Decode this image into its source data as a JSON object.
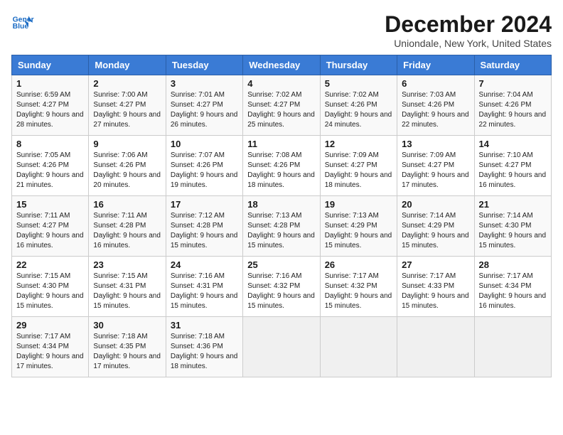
{
  "logo": {
    "line1": "General",
    "line2": "Blue"
  },
  "title": "December 2024",
  "subtitle": "Uniondale, New York, United States",
  "days_of_week": [
    "Sunday",
    "Monday",
    "Tuesday",
    "Wednesday",
    "Thursday",
    "Friday",
    "Saturday"
  ],
  "weeks": [
    [
      {
        "day": "1",
        "sunrise": "6:59 AM",
        "sunset": "4:27 PM",
        "daylight": "9 hours and 28 minutes."
      },
      {
        "day": "2",
        "sunrise": "7:00 AM",
        "sunset": "4:27 PM",
        "daylight": "9 hours and 27 minutes."
      },
      {
        "day": "3",
        "sunrise": "7:01 AM",
        "sunset": "4:27 PM",
        "daylight": "9 hours and 26 minutes."
      },
      {
        "day": "4",
        "sunrise": "7:02 AM",
        "sunset": "4:27 PM",
        "daylight": "9 hours and 25 minutes."
      },
      {
        "day": "5",
        "sunrise": "7:02 AM",
        "sunset": "4:26 PM",
        "daylight": "9 hours and 24 minutes."
      },
      {
        "day": "6",
        "sunrise": "7:03 AM",
        "sunset": "4:26 PM",
        "daylight": "9 hours and 22 minutes."
      },
      {
        "day": "7",
        "sunrise": "7:04 AM",
        "sunset": "4:26 PM",
        "daylight": "9 hours and 22 minutes."
      }
    ],
    [
      {
        "day": "8",
        "sunrise": "7:05 AM",
        "sunset": "4:26 PM",
        "daylight": "9 hours and 21 minutes."
      },
      {
        "day": "9",
        "sunrise": "7:06 AM",
        "sunset": "4:26 PM",
        "daylight": "9 hours and 20 minutes."
      },
      {
        "day": "10",
        "sunrise": "7:07 AM",
        "sunset": "4:26 PM",
        "daylight": "9 hours and 19 minutes."
      },
      {
        "day": "11",
        "sunrise": "7:08 AM",
        "sunset": "4:26 PM",
        "daylight": "9 hours and 18 minutes."
      },
      {
        "day": "12",
        "sunrise": "7:09 AM",
        "sunset": "4:27 PM",
        "daylight": "9 hours and 18 minutes."
      },
      {
        "day": "13",
        "sunrise": "7:09 AM",
        "sunset": "4:27 PM",
        "daylight": "9 hours and 17 minutes."
      },
      {
        "day": "14",
        "sunrise": "7:10 AM",
        "sunset": "4:27 PM",
        "daylight": "9 hours and 16 minutes."
      }
    ],
    [
      {
        "day": "15",
        "sunrise": "7:11 AM",
        "sunset": "4:27 PM",
        "daylight": "9 hours and 16 minutes."
      },
      {
        "day": "16",
        "sunrise": "7:11 AM",
        "sunset": "4:28 PM",
        "daylight": "9 hours and 16 minutes."
      },
      {
        "day": "17",
        "sunrise": "7:12 AM",
        "sunset": "4:28 PM",
        "daylight": "9 hours and 15 minutes."
      },
      {
        "day": "18",
        "sunrise": "7:13 AM",
        "sunset": "4:28 PM",
        "daylight": "9 hours and 15 minutes."
      },
      {
        "day": "19",
        "sunrise": "7:13 AM",
        "sunset": "4:29 PM",
        "daylight": "9 hours and 15 minutes."
      },
      {
        "day": "20",
        "sunrise": "7:14 AM",
        "sunset": "4:29 PM",
        "daylight": "9 hours and 15 minutes."
      },
      {
        "day": "21",
        "sunrise": "7:14 AM",
        "sunset": "4:30 PM",
        "daylight": "9 hours and 15 minutes."
      }
    ],
    [
      {
        "day": "22",
        "sunrise": "7:15 AM",
        "sunset": "4:30 PM",
        "daylight": "9 hours and 15 minutes."
      },
      {
        "day": "23",
        "sunrise": "7:15 AM",
        "sunset": "4:31 PM",
        "daylight": "9 hours and 15 minutes."
      },
      {
        "day": "24",
        "sunrise": "7:16 AM",
        "sunset": "4:31 PM",
        "daylight": "9 hours and 15 minutes."
      },
      {
        "day": "25",
        "sunrise": "7:16 AM",
        "sunset": "4:32 PM",
        "daylight": "9 hours and 15 minutes."
      },
      {
        "day": "26",
        "sunrise": "7:17 AM",
        "sunset": "4:32 PM",
        "daylight": "9 hours and 15 minutes."
      },
      {
        "day": "27",
        "sunrise": "7:17 AM",
        "sunset": "4:33 PM",
        "daylight": "9 hours and 15 minutes."
      },
      {
        "day": "28",
        "sunrise": "7:17 AM",
        "sunset": "4:34 PM",
        "daylight": "9 hours and 16 minutes."
      }
    ],
    [
      {
        "day": "29",
        "sunrise": "7:17 AM",
        "sunset": "4:34 PM",
        "daylight": "9 hours and 17 minutes."
      },
      {
        "day": "30",
        "sunrise": "7:18 AM",
        "sunset": "4:35 PM",
        "daylight": "9 hours and 17 minutes."
      },
      {
        "day": "31",
        "sunrise": "7:18 AM",
        "sunset": "4:36 PM",
        "daylight": "9 hours and 18 minutes."
      },
      null,
      null,
      null,
      null
    ]
  ],
  "labels": {
    "sunrise_prefix": "Sunrise: ",
    "sunset_prefix": "Sunset: ",
    "daylight_prefix": "Daylight: "
  }
}
